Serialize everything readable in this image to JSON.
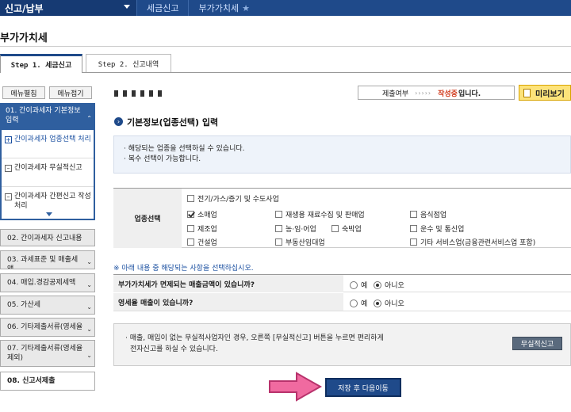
{
  "topnav": {
    "main": "신고/납부",
    "crumb1": "세금신고",
    "crumb2": "부가가치세"
  },
  "page_title": "부가가치세",
  "tabs": {
    "step1": "Step 1. 세금신고",
    "step2": "Step 2. 신고내역"
  },
  "sidebar": {
    "menu_expand": "메뉴펼침",
    "menu_collapse": "메뉴접기",
    "active_item": "01. 간이과세자 기본정보 입력",
    "subitems": [
      {
        "label": "간이과세자 업종선택 처리",
        "marker": "+"
      },
      {
        "label": "간이과세자 무실적신고",
        "marker": "–"
      },
      {
        "label": "간이과세자 간편신고 작성 처리",
        "marker": "–"
      }
    ],
    "items": [
      "02. 간이과세자 신고내용",
      "03. 과세표준 및 매출세액",
      "04. 매입.경감공제세액",
      "05. 가산세",
      "06. 기타제출서류(영세율",
      "07. 기타제출서류(영세율 제외)",
      "08. 신고서제출"
    ]
  },
  "status": {
    "label": "제출여부",
    "arrows": "›››››",
    "value": "작성중",
    "suffix": "입니다.",
    "preview_button": "미리보기"
  },
  "section_title": "기본정보(업종선택) 입력",
  "notes": [
    "· 해당되는 업종을 선택하실 수 있습니다.",
    "· 복수 선택이 가능합니다."
  ],
  "business": {
    "label": "업종선택",
    "options": [
      {
        "label": "전기/가스/증기 및 수도사업",
        "checked": false
      },
      {
        "label": "소매업",
        "checked": true
      },
      {
        "label": "재생용 재료수집 및 판매업",
        "checked": false
      },
      {
        "label": "음식점업",
        "checked": false
      },
      {
        "label": "제조업",
        "checked": false
      },
      {
        "label": "농·임·어업",
        "checked": false
      },
      {
        "label": "숙박업",
        "checked": false
      },
      {
        "label": "운수 및 통신업",
        "checked": false
      },
      {
        "label": "건설업",
        "checked": false
      },
      {
        "label": "부동산임대업",
        "checked": false
      },
      {
        "label": "기타 서비스업(금융관련서비스업 포함)",
        "checked": false
      }
    ]
  },
  "warn_note": "※ 아래 내용 중 해당되는 사항을 선택하십시오.",
  "questions": [
    {
      "label": "부가가치세가 면제되는 매출금액이 있습니까?",
      "yes": "예",
      "no": "아니오",
      "selected": "no"
    },
    {
      "label": "영세율 매출이 있습니까?",
      "yes": "예",
      "no": "아니오",
      "selected": "no"
    }
  ],
  "no_sales": {
    "line1": "· 매출, 매입이 없는 무실적사업자인 경우, 오른쪽 [무실적신고] 버튼을 누르면 편리하게",
    "line2": "전자신고를 하실 수 있습니다.",
    "button": "무실적신고"
  },
  "save_button": "저장 후 다음이동",
  "colors": {
    "nav": "#1f4a8a",
    "active_sidebar": "#2f5f9f",
    "status": "#d03a1c",
    "preview": "#fde37a",
    "arrow": "#f06aa0"
  }
}
